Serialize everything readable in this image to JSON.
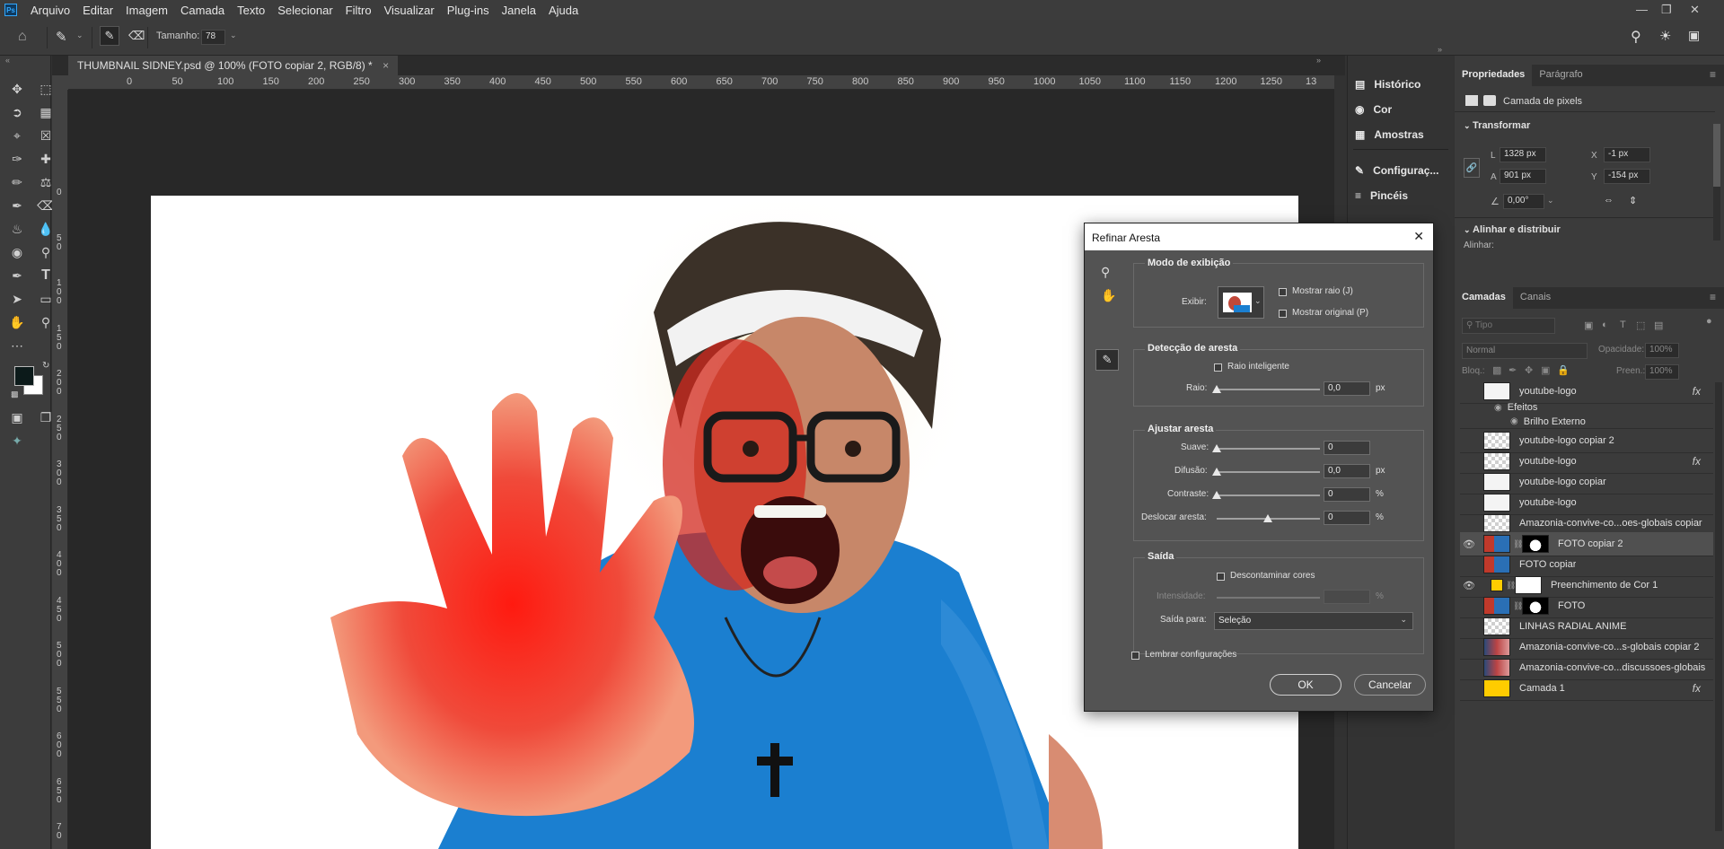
{
  "menu": [
    "Arquivo",
    "Editar",
    "Imagem",
    "Camada",
    "Texto",
    "Selecionar",
    "Filtro",
    "Visualizar",
    "Plug-ins",
    "Janela",
    "Ajuda"
  ],
  "app_logo": "Ps",
  "options": {
    "size_label": "Tamanho:",
    "size_value": "78"
  },
  "document_tab": "THUMBNAIL SIDNEY.psd @ 100% (FOTO copiar 2, RGB/8) *",
  "ruler_h": [
    "0",
    "50",
    "100",
    "150",
    "200",
    "250",
    "300",
    "350",
    "400",
    "450",
    "500",
    "550",
    "600",
    "650",
    "700",
    "750",
    "800",
    "850",
    "900",
    "950",
    "1000",
    "1050",
    "1100",
    "1150",
    "1200",
    "1250",
    "13"
  ],
  "ruler_v": [
    "0",
    "5 0",
    "1 0 0",
    "1 5 0",
    "2 0 0",
    "2 5 0",
    "3 0 0",
    "3 5 0",
    "4 0 0",
    "4 5 0",
    "5 0 0",
    "5 5 0",
    "6 0 0",
    "6 5 0",
    "7 0"
  ],
  "mid_panel": [
    "Histórico",
    "Cor",
    "Amostras",
    "Configuraç...",
    "Pincéis"
  ],
  "properties": {
    "tabs": [
      "Propriedades",
      "Parágrafo"
    ],
    "kind": "Camada de pixels",
    "transform_title": "Transformar",
    "L_label": "L",
    "L_value": "1328 px",
    "A_label": "A",
    "A_value": "901 px",
    "X_label": "X",
    "X_value": "-1 px",
    "Y_label": "Y",
    "Y_value": "-154 px",
    "angle_value": "0,00°",
    "align_title": "Alinhar e distribuir",
    "align_label": "Alinhar:"
  },
  "layers_panel": {
    "tabs": [
      "Camadas",
      "Canais"
    ],
    "search_placeholder": "Tipo",
    "blend_mode": "Normal",
    "opacity_label": "Opacidade:",
    "opacity_value": "100%",
    "lock_label": "Bloq.:",
    "fill_label": "Preen.:",
    "fill_value": "100%",
    "effects_label": "Efeitos",
    "effect_name": "Brilho Externo",
    "layers": [
      {
        "name": "youtube-logo",
        "visible": false,
        "fx": true
      },
      {
        "name": "youtube-logo copiar 2",
        "visible": false,
        "fx": false
      },
      {
        "name": "youtube-logo",
        "visible": false,
        "fx": true
      },
      {
        "name": "youtube-logo copiar",
        "visible": false,
        "fx": false
      },
      {
        "name": "youtube-logo",
        "visible": false,
        "fx": false
      },
      {
        "name": "Amazonia-convive-co...oes-globais copiar",
        "visible": false,
        "fx": false
      },
      {
        "name": "FOTO copiar 2",
        "visible": true,
        "fx": false,
        "selected": true
      },
      {
        "name": "FOTO copiar",
        "visible": false,
        "fx": false
      },
      {
        "name": "Preenchimento de Cor 1",
        "visible": true,
        "fx": false
      },
      {
        "name": "FOTO",
        "visible": false,
        "fx": false
      },
      {
        "name": "LINHAS RADIAL ANIME",
        "visible": false,
        "fx": false
      },
      {
        "name": "Amazonia-convive-co...s-globais copiar 2",
        "visible": false,
        "fx": false
      },
      {
        "name": "Amazonia-convive-co...discussoes-globais",
        "visible": false,
        "fx": false
      },
      {
        "name": "Camada 1",
        "visible": false,
        "fx": true
      }
    ]
  },
  "dialog": {
    "title": "Refinar Aresta",
    "view_mode_title": "Modo de exibição",
    "show_label": "Exibir:",
    "show_radius": "Mostrar raio (J)",
    "show_original": "Mostrar original (P)",
    "edge_detection_title": "Detecção de aresta",
    "smart_radius": "Raio inteligente",
    "radius_label": "Raio:",
    "radius_value": "0,0",
    "radius_unit": "px",
    "adjust_title": "Ajustar aresta",
    "smooth_label": "Suave:",
    "smooth_value": "0",
    "feather_label": "Difusão:",
    "feather_value": "0,0",
    "feather_unit": "px",
    "contrast_label": "Contraste:",
    "contrast_value": "0",
    "contrast_unit": "%",
    "shift_label": "Deslocar aresta:",
    "shift_value": "0",
    "shift_unit": "%",
    "output_title": "Saída",
    "decontaminate": "Descontaminar cores",
    "amount_label": "Intensidade:",
    "amount_unit": "%",
    "output_to_label": "Saída para:",
    "output_to_value": "Seleção",
    "remember": "Lembrar configurações",
    "ok": "OK",
    "cancel": "Cancelar"
  },
  "colors": {
    "accent_yellow": "#ffcc00",
    "bg_panel": "#3b3b3b"
  }
}
